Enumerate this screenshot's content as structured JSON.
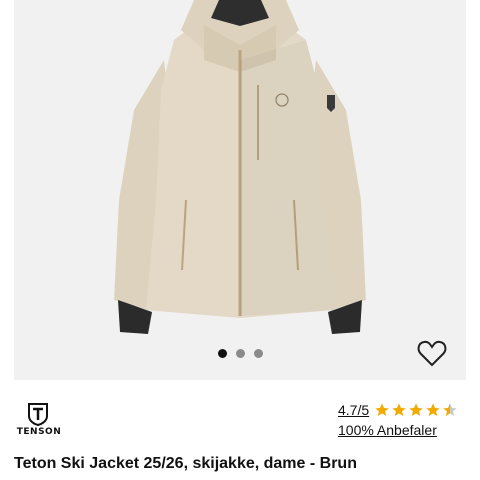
{
  "product": {
    "title": "Teton Ski Jacket 25/26, skijakke, dame - Brun",
    "brand": "TENSON",
    "rating": "4.7/5",
    "rating_stars": 4.7,
    "recommend_text": "100% Anbefaler",
    "image_alt": "Teton Ski Jacket beige",
    "star_color": "#f2a900",
    "jacket_color": "#e3d9c6"
  },
  "gallery": {
    "image_count": 3,
    "active_index": 0
  },
  "icons": {
    "wishlist": "heart-outline-icon",
    "brand": "tenson-logo-icon",
    "star": "star-icon"
  }
}
